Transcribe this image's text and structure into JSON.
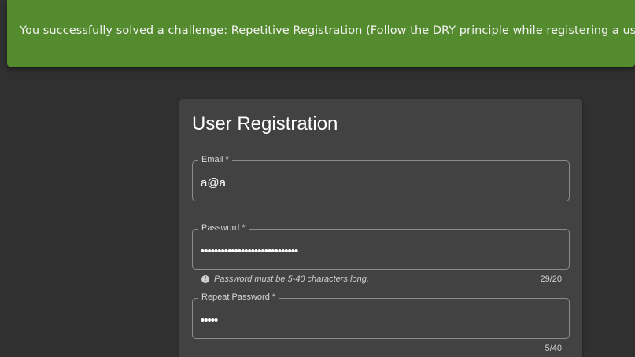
{
  "snackbar": {
    "message": "You successfully solved a challenge: Repetitive Registration (Follow the DRY principle while registering a user.)",
    "color": "#558b2f"
  },
  "registration": {
    "title": "User Registration",
    "email": {
      "label": "Email *",
      "value": "a@a"
    },
    "password": {
      "label": "Password *",
      "masked_value": "•••••••••••••••••••••••••••••",
      "hint_icon": "exclamation-circle-icon",
      "hint": "Password must be 5-40 characters long.",
      "counter": "29/20"
    },
    "repeat_password": {
      "label": "Repeat Password *",
      "masked_value": "•••••",
      "counter": "5/40"
    }
  }
}
